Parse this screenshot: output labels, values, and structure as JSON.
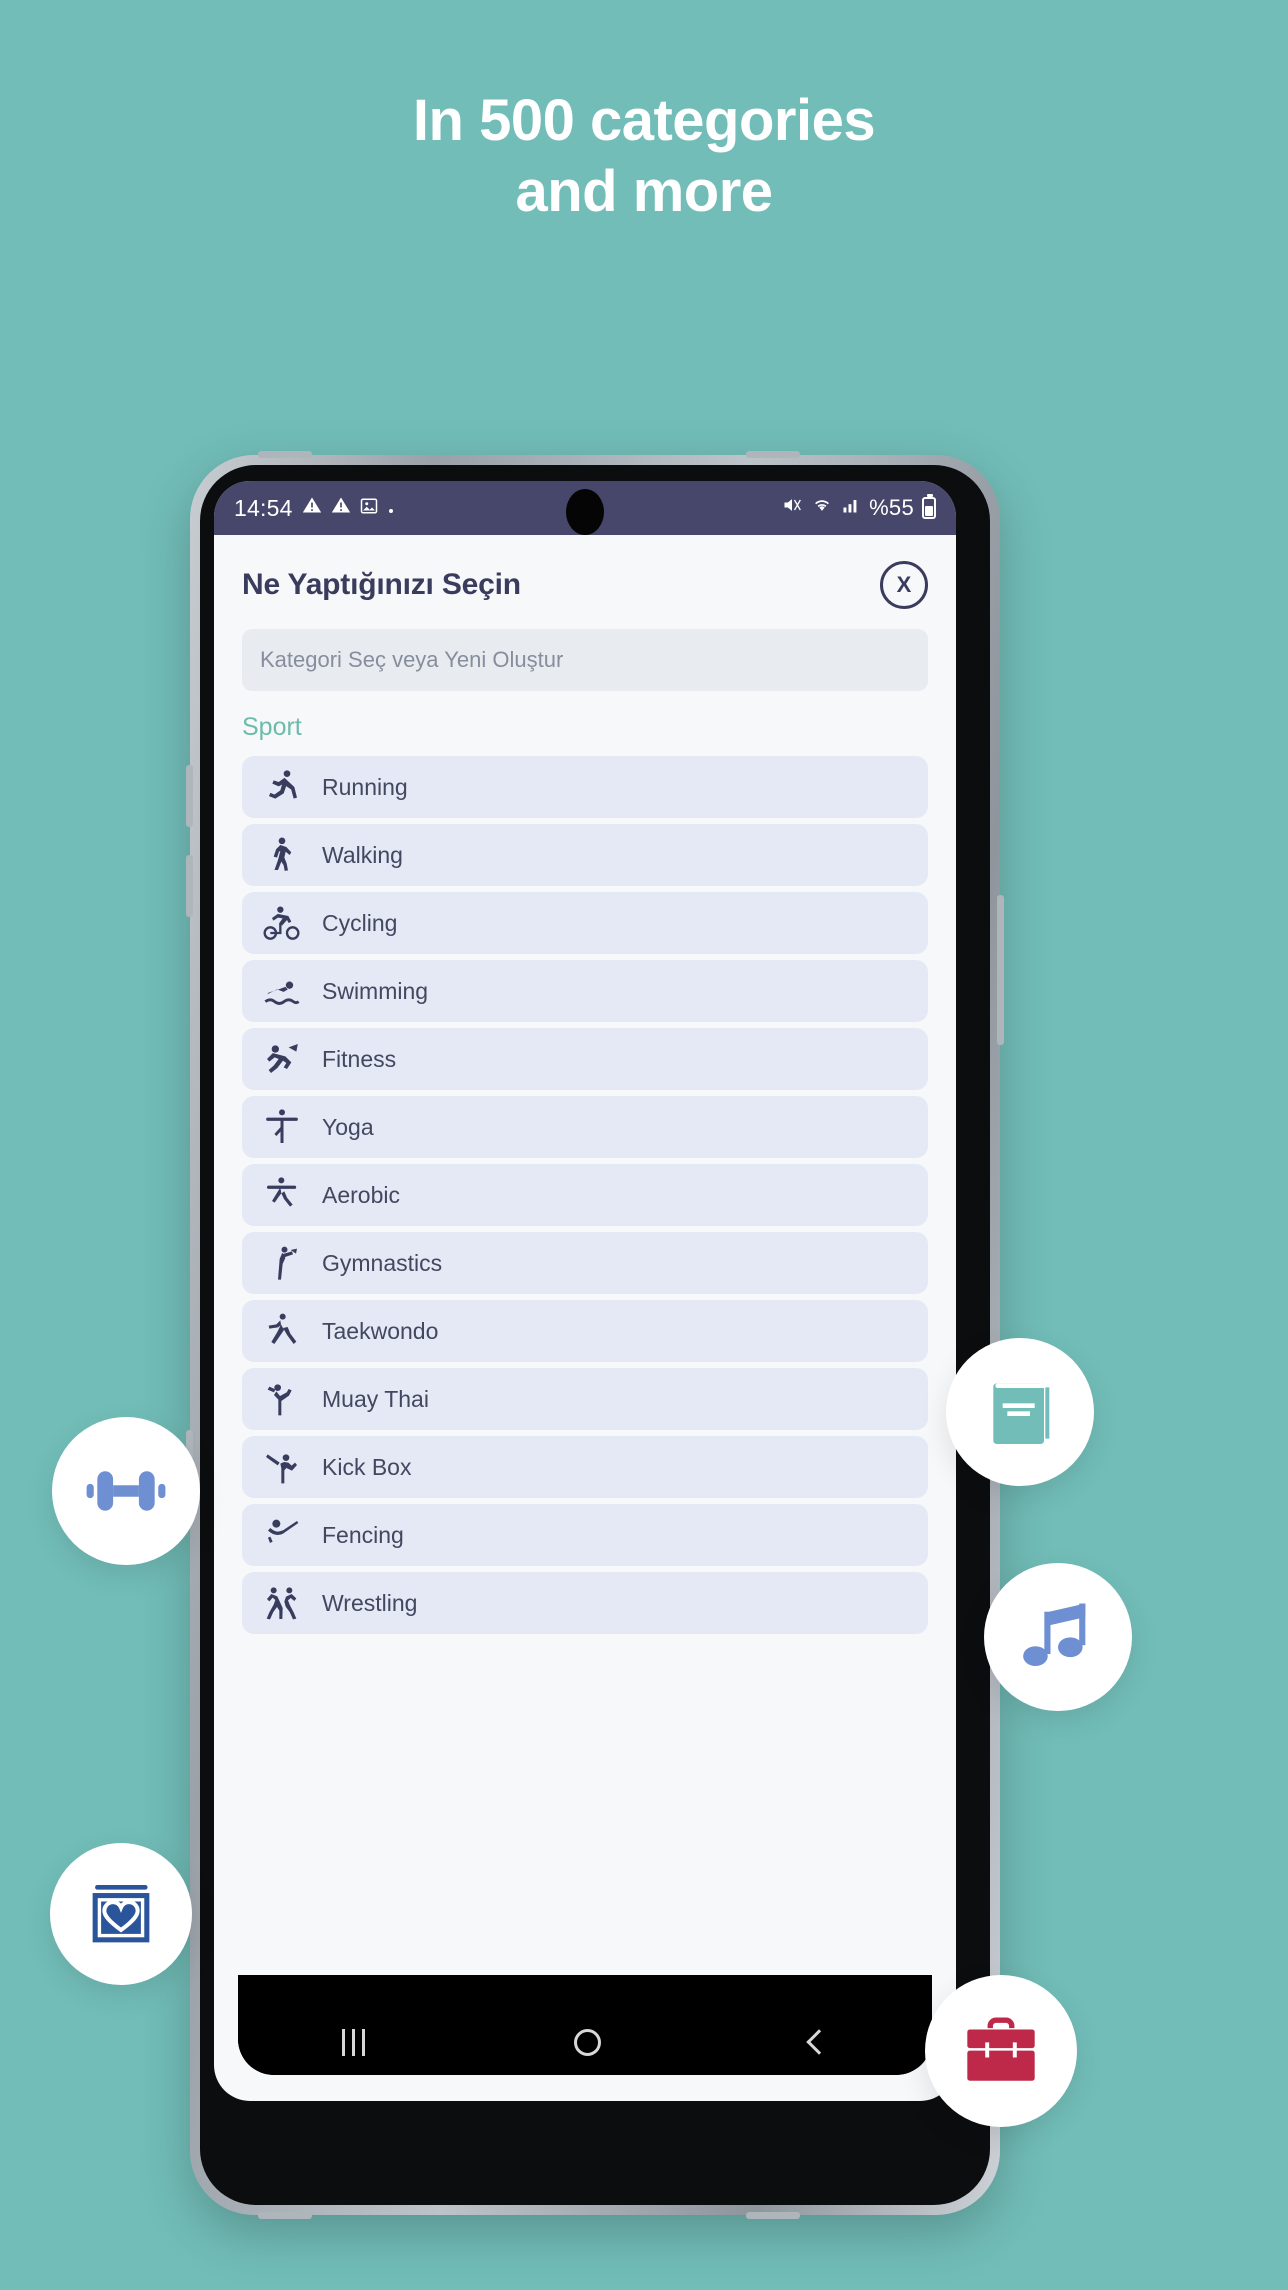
{
  "promo": {
    "headline_line1": "In 500 categories",
    "headline_line2": "and more",
    "background_color": "#72bdb8",
    "headline_color": "#ffffff"
  },
  "phone": {
    "status_bar": {
      "time": "14:54",
      "left_icons": [
        "warning-icon",
        "warning-icon",
        "image-icon",
        "dot-icon"
      ],
      "right_icons": [
        "mute-icon",
        "wifi-icon",
        "signal-icon"
      ],
      "battery_percent": "%55",
      "background_color": "#46476b"
    },
    "navigation_bar": {
      "recent_label": "recent-apps",
      "home_label": "home",
      "back_label": "back"
    }
  },
  "app": {
    "title": "Ne Yaptığınızı Seçin",
    "close_label": "X",
    "search": {
      "value": "",
      "placeholder": "Kategori Seç veya Yeni Oluştur"
    },
    "section_label": "Sport",
    "section_label_color": "#6dbbab",
    "item_background_color": "#e4e9f5",
    "items": [
      {
        "label": "Running",
        "icon": "running-icon"
      },
      {
        "label": "Walking",
        "icon": "walking-icon"
      },
      {
        "label": "Cycling",
        "icon": "cycling-icon"
      },
      {
        "label": "Swimming",
        "icon": "swimming-icon"
      },
      {
        "label": "Fitness",
        "icon": "fitness-icon"
      },
      {
        "label": "Yoga",
        "icon": "yoga-icon"
      },
      {
        "label": "Aerobic",
        "icon": "aerobic-icon"
      },
      {
        "label": "Gymnastics",
        "icon": "gymnastics-icon"
      },
      {
        "label": "Taekwondo",
        "icon": "taekwondo-icon"
      },
      {
        "label": "Muay Thai",
        "icon": "muay-thai-icon"
      },
      {
        "label": "Kick Box",
        "icon": "kick-box-icon"
      },
      {
        "label": "Fencing",
        "icon": "fencing-icon"
      },
      {
        "label": "Wrestling",
        "icon": "wrestling-icon"
      }
    ]
  },
  "badges": [
    {
      "name": "dumbbell-icon",
      "color": "#6e8fd1"
    },
    {
      "name": "book-icon",
      "color": "#72bdb8"
    },
    {
      "name": "music-note-icon",
      "color": "#6e8fd1"
    },
    {
      "name": "heart-book-icon",
      "color": "#2b559a"
    },
    {
      "name": "briefcase-icon",
      "color": "#bf2949"
    }
  ]
}
